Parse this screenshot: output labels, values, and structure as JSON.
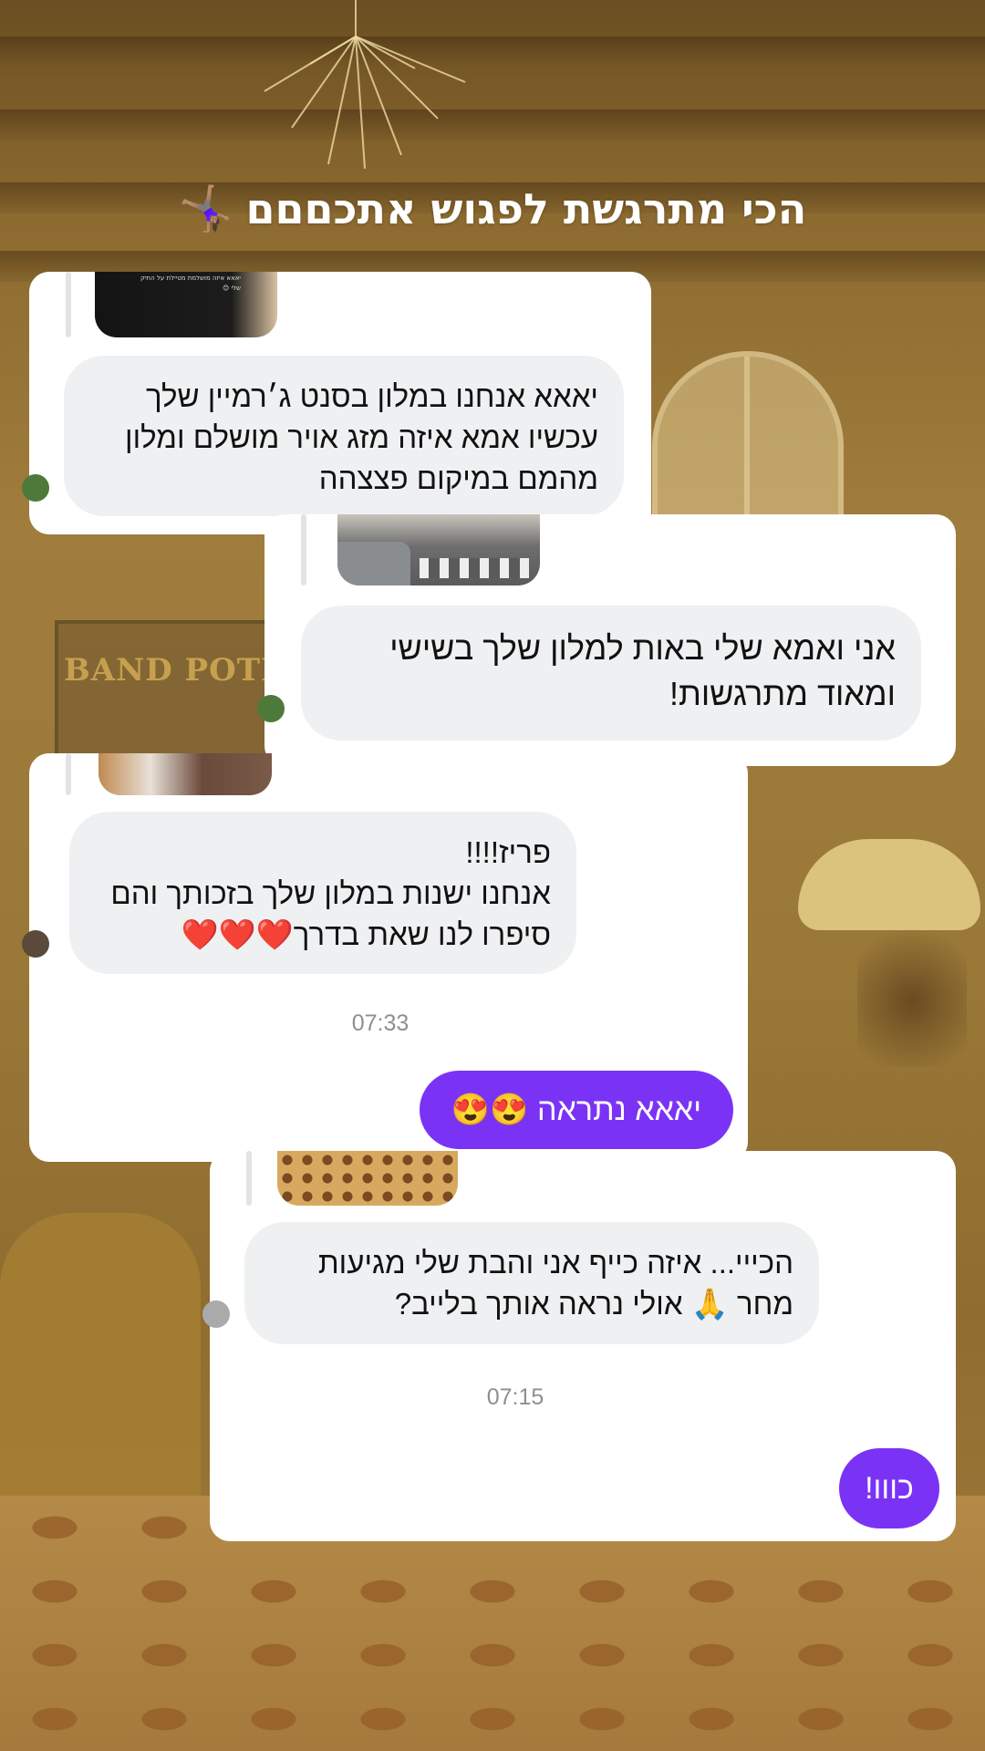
{
  "title": {
    "text": "הכי מתרגשת לפגוש אתכםםם",
    "emoji": "🤸🏽‍♀️"
  },
  "thumb_caption": "יאאא איזה מושלמת מטיילת על התיק שלי 😊",
  "cards": [
    {
      "message_lines": [
        "יאאא אנחנו במלון בסנט ג׳רמיין שלך",
        "עכשיו אמא איזה מזג אויר מושלם ומלון",
        "מהמם במיקום פצצהה"
      ]
    },
    {
      "message_lines": [
        "אני ואמא שלי באות למלון שלך בשישי",
        "ומאוד מתרגשות!"
      ]
    },
    {
      "message_lines": [
        "פריז!!!!",
        "אנחנו ישנות במלון שלך בזכותך והם",
        "סיפרו לנו שאת בדרך❤️❤️❤️"
      ],
      "time": "07:33",
      "reply": "יאאא נתראה 😍😍"
    },
    {
      "message_lines": [
        "הכייי... איזה כייף אני והבת שלי מגיעות",
        "מחר 🙏 אולי נראה אותך בלייב?"
      ],
      "time": "07:15",
      "reply": "כווו!"
    }
  ]
}
